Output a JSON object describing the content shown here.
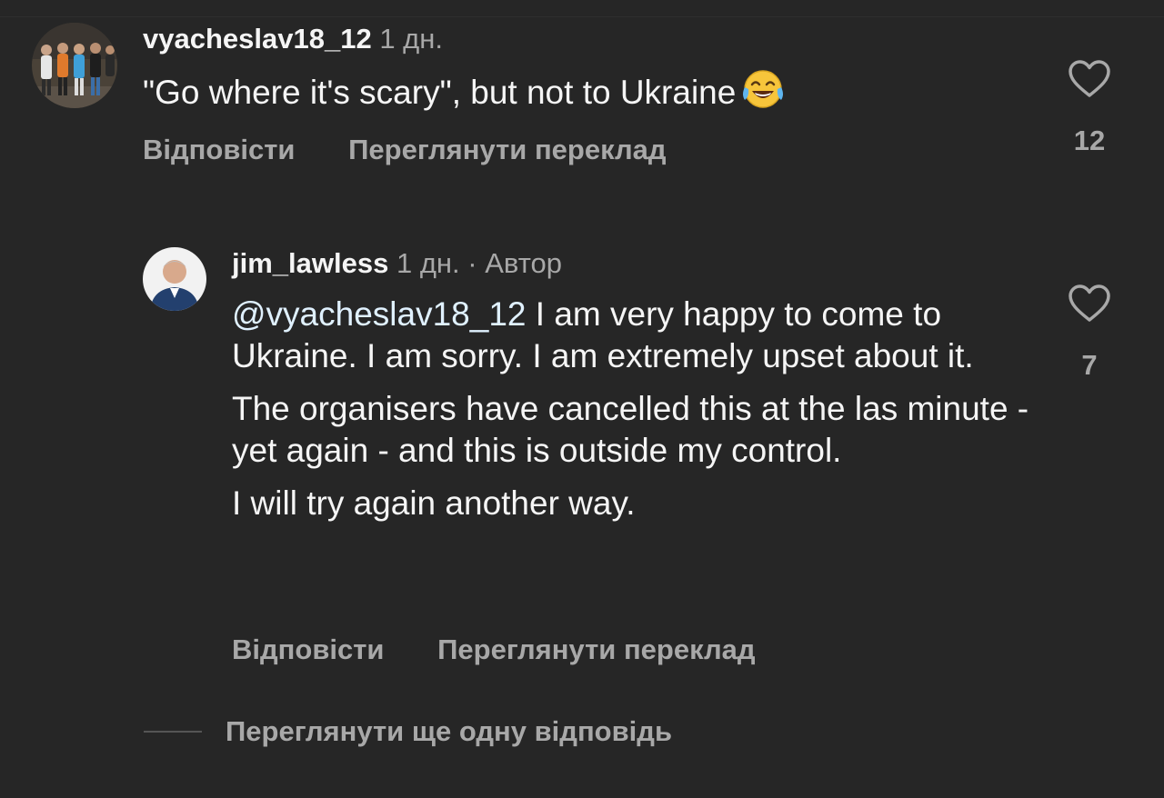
{
  "comments": [
    {
      "username": "vyacheslav18_12",
      "time": "1 дн.",
      "text": "\"Go where it's scary\", but not to Ukraine",
      "emoji": "face-with-tears-of-joy",
      "reply_label": "Відповісти",
      "translate_label": "Переглянути переклад",
      "likes": "12"
    }
  ],
  "reply": {
    "username": "jim_lawless",
    "time": "1 дн.",
    "separator": "·",
    "author_tag": "Автор",
    "mention": "@vyacheslav18_12",
    "paragraph1": "I am very happy to come to Ukraine. I am sorry. I am extremely upset about it.",
    "paragraph2": "The organisers have cancelled this at the las minute - yet again - and this is outside my control.",
    "paragraph3": "I will try again another way.",
    "reply_label": "Відповісти",
    "translate_label": "Переглянути переклад",
    "likes": "7"
  },
  "more_replies_label": "Переглянути ще одну відповідь",
  "colors": {
    "background": "#262626",
    "primary_text": "#f5f5f5",
    "secondary_text": "#a8a8a8",
    "mention": "#e0f1ff"
  }
}
